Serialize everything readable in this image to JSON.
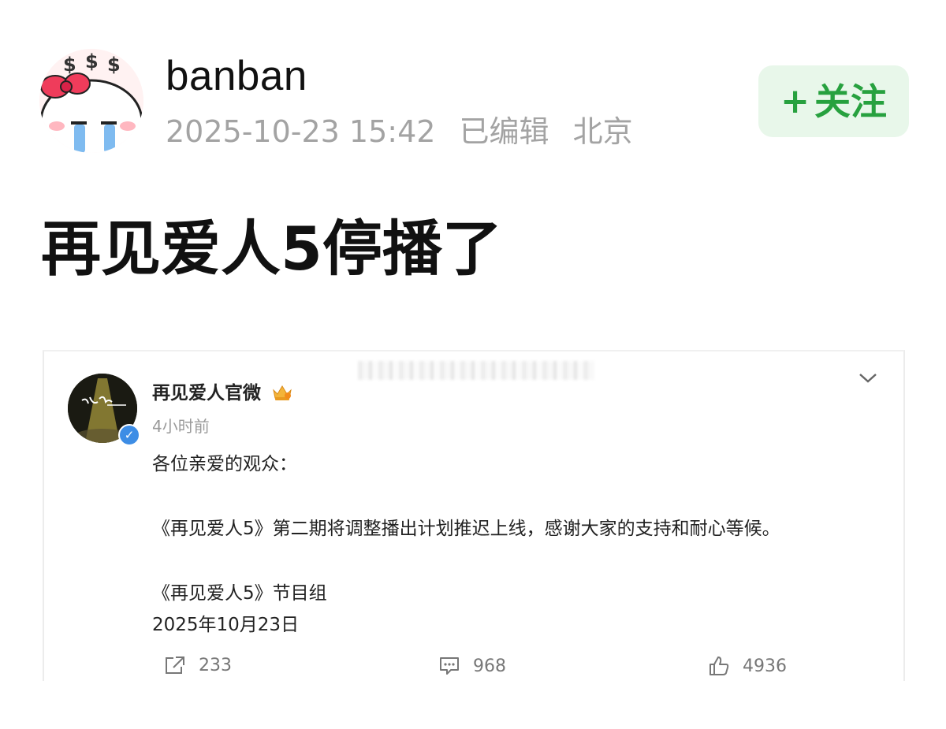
{
  "post": {
    "username": "banban",
    "timestamp": "2025-10-23 15:42",
    "edited": "已编辑",
    "location": "北京",
    "follow_plus": "+",
    "follow_label": "关注",
    "text": "再见爱人5停播了"
  },
  "embedded": {
    "account_name": "再见爱人官微",
    "time_ago": "4小时前",
    "greeting": "各位亲爱的观众：",
    "body": "《再见爱人5》第二期将调整播出计划推迟上线，感谢大家的支持和耐心等候。",
    "signature": "《再见爱人5》节目组",
    "date": "2025年10月23日",
    "reposts": "233",
    "comments": "968",
    "likes": "4936"
  },
  "colors": {
    "accent_green": "#27a13f",
    "follow_bg": "#e8f7ea",
    "meta_gray": "#a3a3a3",
    "verified_blue": "#3d8de5"
  },
  "icons": {
    "chevron": "chevron-down-icon",
    "verified": "verified-badge-icon",
    "crown": "crown-badge-icon",
    "share": "share-icon",
    "comment": "comment-icon",
    "like": "thumbs-up-icon"
  }
}
